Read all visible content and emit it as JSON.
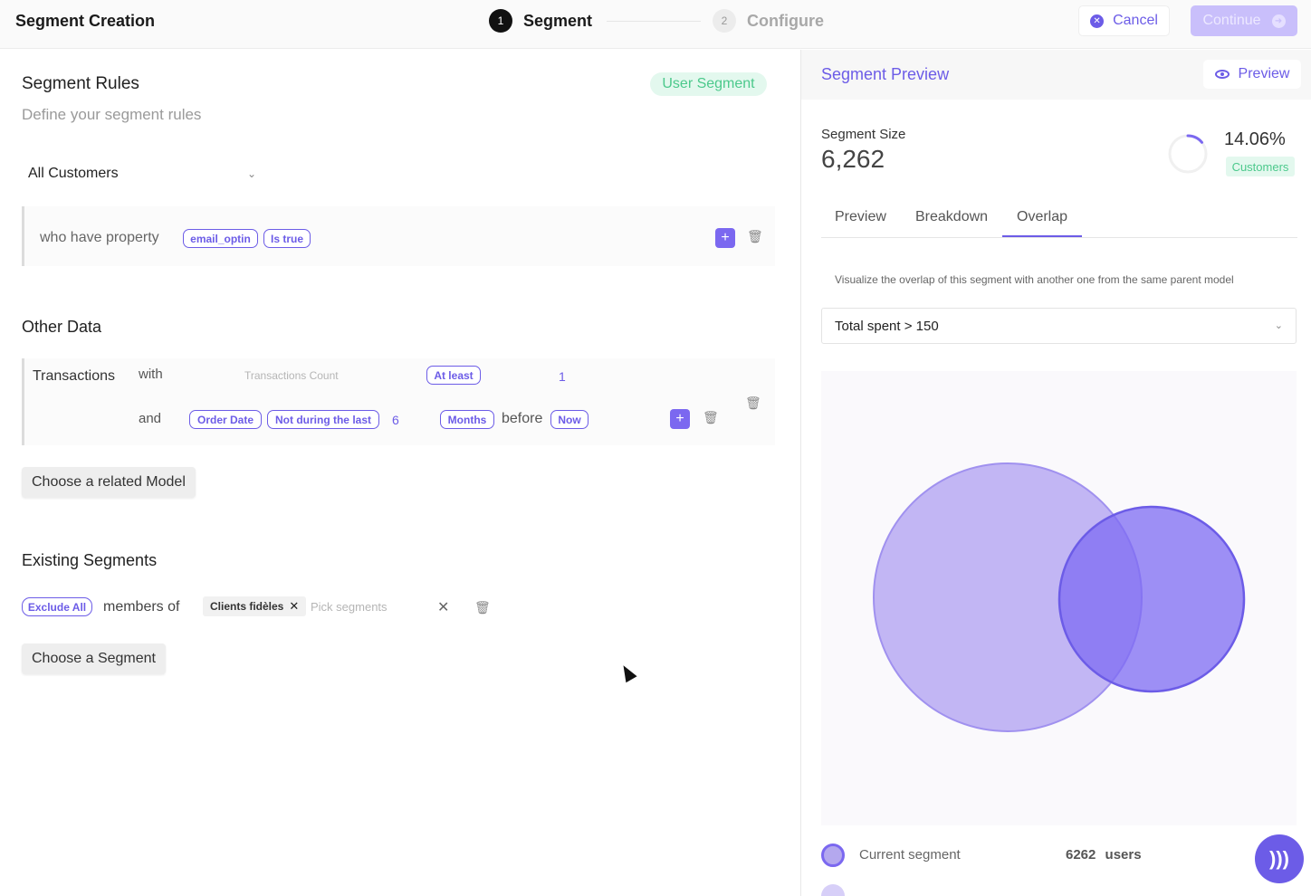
{
  "header": {
    "title": "Segment Creation",
    "steps": [
      {
        "num": "1",
        "label": "Segment"
      },
      {
        "num": "2",
        "label": "Configure"
      }
    ],
    "cancel_label": "Cancel",
    "continue_label": "Continue"
  },
  "rules": {
    "title": "Segment Rules",
    "subtitle": "Define your segment rules",
    "badge": "User Segment",
    "scope": "All Customers",
    "condition_text": "who have property",
    "property": "email_optin",
    "operator": "Is true"
  },
  "other_data": {
    "title": "Other Data",
    "model": "Transactions",
    "with_label": "with",
    "metric_placeholder": "Transactions Count",
    "comparator": "At least",
    "count": "1",
    "and_label": "and",
    "date_field": "Order Date",
    "time_op": "Not during the last",
    "time_value": "6",
    "time_unit": "Months",
    "before_label": "before",
    "anchor": "Now",
    "related_button": "Choose a related Model"
  },
  "existing": {
    "title": "Existing Segments",
    "mode": "Exclude All",
    "members_of": "members of",
    "chip": "Clients fidèles",
    "placeholder": "Pick segments",
    "choose_button": "Choose a Segment"
  },
  "preview": {
    "title": "Segment Preview",
    "button": "Preview",
    "size_label": "Segment Size",
    "size_value": "6,262",
    "percent": "14.06%",
    "percent_fraction": 0.1406,
    "percent_badge": "Customers",
    "tabs": [
      "Preview",
      "Breakdown",
      "Overlap"
    ],
    "active_tab": "Overlap",
    "overlap_desc": "Visualize the overlap of this segment with another one from the same parent model",
    "compare_segment": "Total spent > 150",
    "legend": [
      {
        "label": "Current segment",
        "value": "6262",
        "unit": "users"
      }
    ]
  },
  "colors": {
    "accent": "#6c5ce7",
    "success_bg": "#e3f8ee",
    "success_text": "#4cc98c"
  }
}
